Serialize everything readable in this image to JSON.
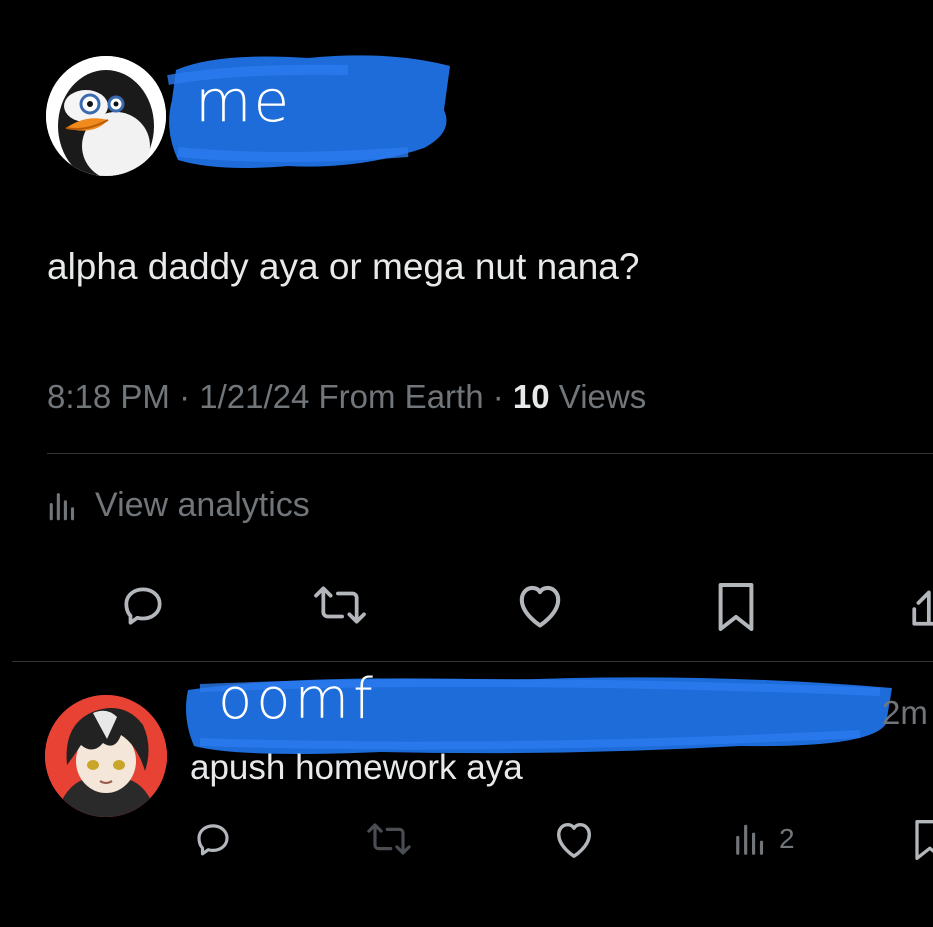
{
  "tweet": {
    "author_handle_overlay": "me",
    "text": "alpha daddy aya or mega nut nana?",
    "time": "8:18 PM",
    "separator": "·",
    "date_location": "1/21/24 From Earth",
    "views_count": "10",
    "views_label": "Views",
    "analytics_label": "View analytics",
    "avatar_icon": "penguin-avatar-icon"
  },
  "reply": {
    "author_handle_overlay": "oomf",
    "time": "2m",
    "text": "apush homework aya",
    "views_count": "2",
    "avatar_icon": "anime-character-avatar-icon"
  },
  "colors": {
    "background": "#000000",
    "text_primary": "#e7e9ea",
    "text_secondary": "#71767b",
    "divider": "#2f3336",
    "scribble": "#1f6fe0"
  }
}
